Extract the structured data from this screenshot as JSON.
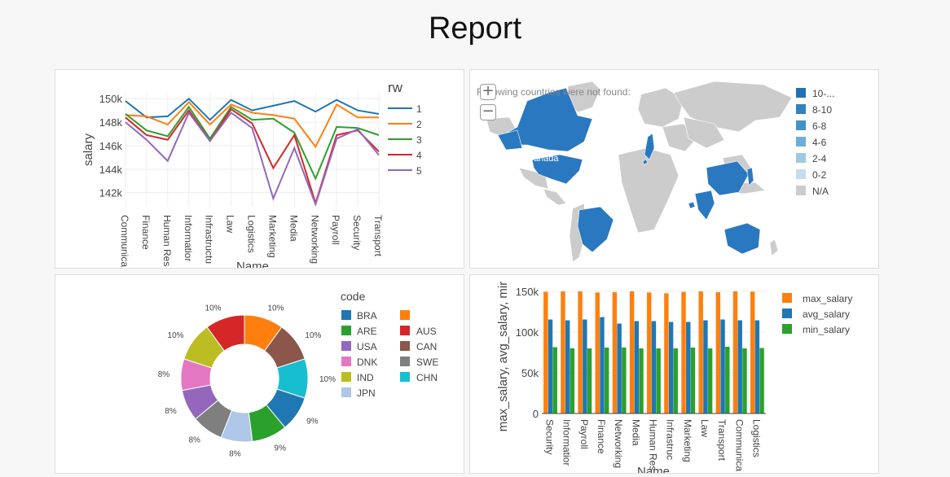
{
  "page": {
    "title": "Report"
  },
  "colors": {
    "blue": "#1f77b4",
    "orange": "#ff7f0e",
    "green": "#2ca02c",
    "red": "#d62728",
    "purple": "#9467bd",
    "brown": "#8c564b",
    "pink": "#e377c2",
    "gray": "#7f7f7f",
    "olive": "#bcbd22",
    "cyan": "#17becf",
    "lightblue": "#aec7e8"
  },
  "map": {
    "not_found_text": "Following countries were not found:",
    "zoom_in": "+",
    "zoom_out": "−",
    "country_label": "Canada",
    "legend": [
      "10-...",
      "8-10",
      "6-8",
      "4-6",
      "2-4",
      "0-2",
      "N/A"
    ],
    "legend_colors": [
      "#2171b5",
      "#3182bd",
      "#4292c6",
      "#6baed6",
      "#9ecae1",
      "#c6dbef",
      "#cccccc"
    ],
    "highlighted_color": "#2a78c0",
    "land_color": "#cccccc"
  },
  "chart_data": [
    {
      "type": "line",
      "xlabel": "Name",
      "ylabel": "salary",
      "legend_title": "rw",
      "categories": [
        "Communica",
        "Finance",
        "Human Res",
        "Informatior",
        "Infrastructu",
        "Law",
        "Logistics",
        "Marketing",
        "Media",
        "Networking",
        "Payroll",
        "Security",
        "Transport"
      ],
      "yticks": [
        142000,
        144000,
        146000,
        148000,
        150000
      ],
      "ytick_labels": [
        "142k",
        "144k",
        "146k",
        "148k",
        "150k"
      ],
      "ylim": [
        140800,
        150500
      ],
      "series": [
        {
          "name": "1",
          "values": [
            149800,
            148400,
            148500,
            150000,
            148200,
            149900,
            149000,
            149400,
            149800,
            148900,
            149900,
            149000,
            148700
          ]
        },
        {
          "name": "2",
          "values": [
            148600,
            148500,
            147800,
            149700,
            147800,
            149500,
            148800,
            148600,
            148300,
            145900,
            149500,
            148400,
            148400
          ]
        },
        {
          "name": "3",
          "values": [
            148700,
            147300,
            146800,
            149300,
            146600,
            149300,
            148200,
            148300,
            147100,
            143200,
            147600,
            147500,
            146900
          ]
        },
        {
          "name": "4",
          "values": [
            148400,
            146900,
            146500,
            149000,
            146400,
            149100,
            147900,
            144100,
            146900,
            141100,
            146900,
            147300,
            145500
          ]
        },
        {
          "name": "5",
          "values": [
            148000,
            146500,
            144700,
            148800,
            146400,
            148800,
            147500,
            141500,
            145800,
            141000,
            146600,
            147400,
            145200
          ]
        }
      ],
      "grid": true,
      "legend_position": "right"
    },
    {
      "type": "pie",
      "legend_title": "code",
      "hole": true,
      "slices": [
        {
          "label": "",
          "value": 10,
          "text": "10%",
          "color": "#ff7f0e"
        },
        {
          "label": "CAN",
          "value": 10,
          "text": "10%",
          "color": "#8c564b"
        },
        {
          "label": "CHN",
          "value": 10,
          "text": "10%",
          "color": "#17becf"
        },
        {
          "label": "BRA",
          "value": 9,
          "text": "9%",
          "color": "#1f77b4"
        },
        {
          "label": "ARE",
          "value": 9,
          "text": "9%",
          "color": "#2ca02c"
        },
        {
          "label": "JPN",
          "value": 8,
          "text": "8%",
          "color": "#aec7e8"
        },
        {
          "label": "SWE",
          "value": 8,
          "text": "8%",
          "color": "#7f7f7f"
        },
        {
          "label": "USA",
          "value": 8,
          "text": "8%",
          "color": "#9467bd"
        },
        {
          "label": "DNK",
          "value": 8,
          "text": "8%",
          "color": "#e377c2"
        },
        {
          "label": "IND",
          "value": 10,
          "text": "10%",
          "color": "#bcbd22"
        },
        {
          "label": "AUS",
          "value": 10,
          "text": "10%",
          "color": "#d62728"
        }
      ],
      "legend_col1": [
        {
          "label": "BRA",
          "color": "#1f77b4"
        },
        {
          "label": "ARE",
          "color": "#2ca02c"
        },
        {
          "label": "USA",
          "color": "#9467bd"
        },
        {
          "label": "DNK",
          "color": "#e377c2"
        },
        {
          "label": "IND",
          "color": "#bcbd22"
        },
        {
          "label": "JPN",
          "color": "#aec7e8"
        }
      ],
      "legend_col2": [
        {
          "label": "",
          "color": "#ff7f0e"
        },
        {
          "label": "AUS",
          "color": "#d62728"
        },
        {
          "label": "CAN",
          "color": "#8c564b"
        },
        {
          "label": "SWE",
          "color": "#7f7f7f"
        },
        {
          "label": "CHN",
          "color": "#17becf"
        }
      ]
    },
    {
      "type": "bar",
      "xlabel": "Name",
      "ylabel": "max_salary, avg_salary, mir",
      "categories": [
        "Security",
        "Informatior",
        "Payroll",
        "Finance",
        "Networking",
        "Media",
        "Human Res",
        "Infrastruc",
        "Marketing",
        "Law",
        "Transport",
        "Communica",
        "Logistics"
      ],
      "yticks": [
        0,
        50000,
        100000,
        150000
      ],
      "ytick_labels": [
        "0",
        "50k",
        "100k",
        "150k"
      ],
      "ylim": [
        0,
        150000
      ],
      "series": [
        {
          "name": "max_salary",
          "color": "#ff7f0e",
          "values": [
            149500,
            150000,
            150000,
            148700,
            149000,
            150000,
            148700,
            147700,
            149400,
            150000,
            149000,
            150000,
            149700
          ]
        },
        {
          "name": "avg_salary",
          "color": "#1f77b4",
          "values": [
            115500,
            114500,
            115500,
            118500,
            110500,
            113500,
            113500,
            112500,
            112500,
            114500,
            115500,
            114500,
            114500
          ]
        },
        {
          "name": "min_salary",
          "color": "#2ca02c",
          "values": [
            81500,
            80000,
            80000,
            81000,
            81000,
            80000,
            80000,
            80000,
            81000,
            80000,
            82000,
            80000,
            80500
          ]
        }
      ],
      "legend_position": "right"
    }
  ]
}
